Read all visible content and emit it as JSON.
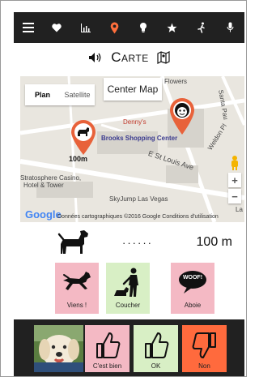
{
  "nav": {
    "items": [
      {
        "icon": "menu-icon",
        "color": "#ffffff"
      },
      {
        "icon": "heart-icon",
        "color": "#ffffff"
      },
      {
        "icon": "chart-icon",
        "color": "#ffffff"
      },
      {
        "icon": "location-pin-icon",
        "color": "#ff6f3c",
        "selected": true
      },
      {
        "icon": "bulb-icon",
        "color": "#ffffff"
      },
      {
        "icon": "star-icon",
        "color": "#ffffff"
      },
      {
        "icon": "walk-icon",
        "color": "#ffffff"
      },
      {
        "icon": "microphone-icon",
        "color": "#ffffff"
      }
    ]
  },
  "header": {
    "title": "Carte"
  },
  "map": {
    "type_plan": "Plan",
    "type_satellite": "Satellite",
    "center_button": "Center Map",
    "dog_distance_label": "100m",
    "places": {
      "flowers": "Flowers",
      "dennys": "Denny's",
      "brooks": "Brooks Shopping Center",
      "weldon": "Weldon Pl",
      "santa": "Santa Pau",
      "stlouis": "E St Louis Ave",
      "strato": "Stratosphere Casino,",
      "strato2": "Hotel & Tower",
      "skyjump": "SkyJump Las Vegas",
      "la": "La"
    },
    "zoom_in": "+",
    "zoom_out": "−",
    "google_logo": "Google",
    "attribution": "Données cartographiques ©2016 Google   Conditions d'utilisation"
  },
  "distance": {
    "dots": "······",
    "value": "100 m"
  },
  "commands": [
    {
      "label": "Viens !",
      "icon": "running-dog-icon",
      "bg": "#f4b9c4"
    },
    {
      "label": "Coucher",
      "icon": "lie-down-icon",
      "bg": "#d8efc5"
    },
    {
      "label": "Aboie",
      "icon": "woof-icon",
      "bg": "#f4b9c4",
      "bubble_text": "WOOF!"
    }
  ],
  "feedback": {
    "photo_alt": "dog-photo",
    "buttons": [
      {
        "label": "C'est bien",
        "icon": "thumbs-up-icon",
        "bg": "#f4b9c4"
      },
      {
        "label": "OK",
        "icon": "thumbs-up-icon",
        "bg": "#d8efc5"
      },
      {
        "label": "Non",
        "icon": "thumbs-down-icon",
        "bg": "#ff6a3d"
      }
    ]
  },
  "colors": {
    "accent": "#ff6f3c",
    "bar": "#212121",
    "pin": "#e8623a"
  }
}
